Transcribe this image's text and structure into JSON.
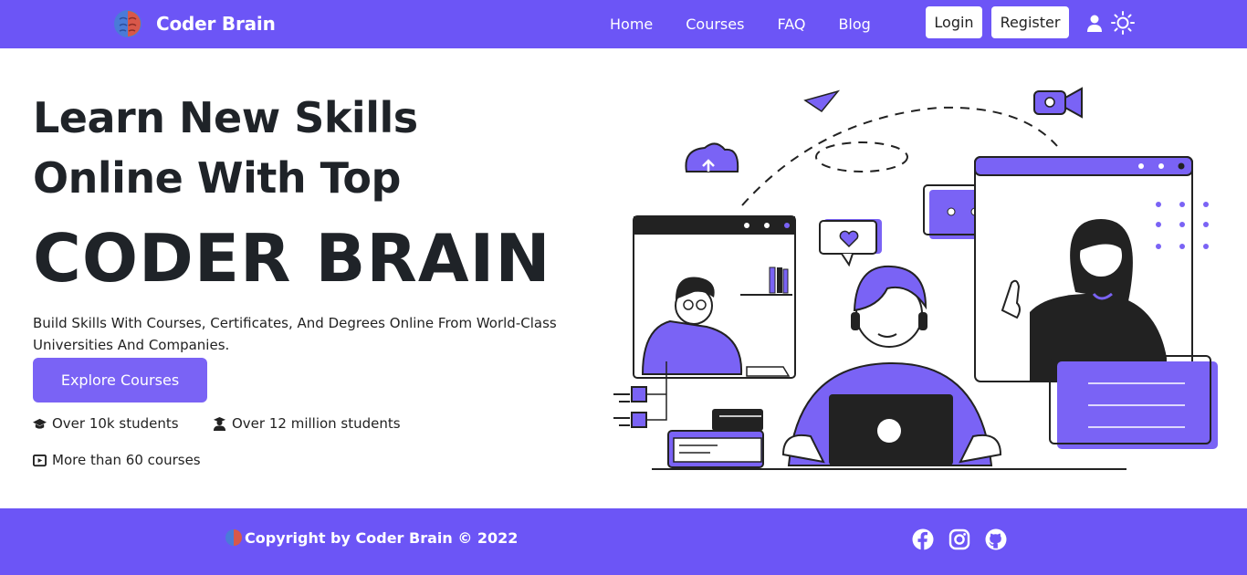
{
  "navbar": {
    "brand": "Coder Brain",
    "links": [
      "Home",
      "Courses",
      "FAQ",
      "Blog"
    ],
    "login_label": "Login",
    "register_label": "Register",
    "icons": [
      "brain-logo-icon",
      "user-icon",
      "sun-icon"
    ],
    "background": "#6c55f6"
  },
  "hero": {
    "line1": "Learn New Skills",
    "line2": "Online With Top",
    "big": "CODER BRAIN",
    "description": "Build Skills With Courses, Certificates, And Degrees Online From World-Class Universities And Companies.",
    "cta_label": "Explore Courses",
    "stats": [
      {
        "icon": "graduation-cap-icon",
        "text": "Over 10k students"
      },
      {
        "icon": "user-graduate-icon",
        "text": "Over 12 million students"
      },
      {
        "icon": "video-icon",
        "text": "More than 60 courses"
      }
    ],
    "accent": "#7a63f5"
  },
  "footer": {
    "copyright": "Copyright by Coder Brain © 2022",
    "social": [
      "facebook-icon",
      "instagram-icon",
      "github-icon"
    ]
  }
}
